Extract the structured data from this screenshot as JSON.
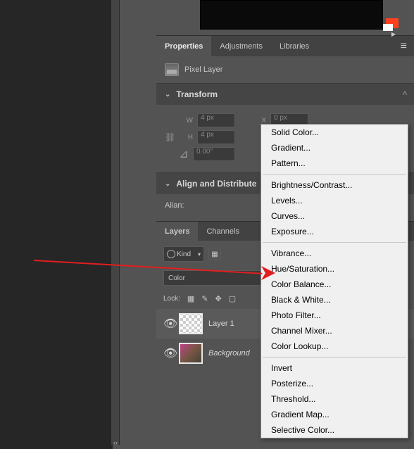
{
  "tabs": {
    "properties": "Properties",
    "adjustments": "Adjustments",
    "libraries": "Libraries"
  },
  "properties": {
    "layer_type": "Pixel Layer"
  },
  "transform": {
    "title": "Transform",
    "w_label": "W",
    "w_value": "4 px",
    "h_label": "H",
    "h_value": "4 px",
    "x_label": "X",
    "x_value": "0 px",
    "angle_value": "0.00°"
  },
  "align": {
    "title": "Align and Distribute",
    "row1": "Alian:"
  },
  "layers_tabs": {
    "layers": "Layers",
    "channels": "Channels"
  },
  "layers_panel": {
    "kind": "Kind",
    "color_mode": "Color",
    "lock_label": "Lock:",
    "items": [
      {
        "name": "Layer 1",
        "italic": false,
        "selected": true,
        "thumb": "checker"
      },
      {
        "name": "Background",
        "italic": true,
        "selected": false,
        "thumb": "bg"
      }
    ]
  },
  "context_menu": {
    "groups": [
      [
        "Solid Color...",
        "Gradient...",
        "Pattern..."
      ],
      [
        "Brightness/Contrast...",
        "Levels...",
        "Curves...",
        "Exposure..."
      ],
      [
        "Vibrance...",
        "Hue/Saturation...",
        "Color Balance...",
        "Black & White...",
        "Photo Filter...",
        "Channel Mixer...",
        "Color Lookup..."
      ],
      [
        "Invert",
        "Posterize...",
        "Threshold...",
        "Gradient Map...",
        "Selective Color..."
      ]
    ]
  }
}
